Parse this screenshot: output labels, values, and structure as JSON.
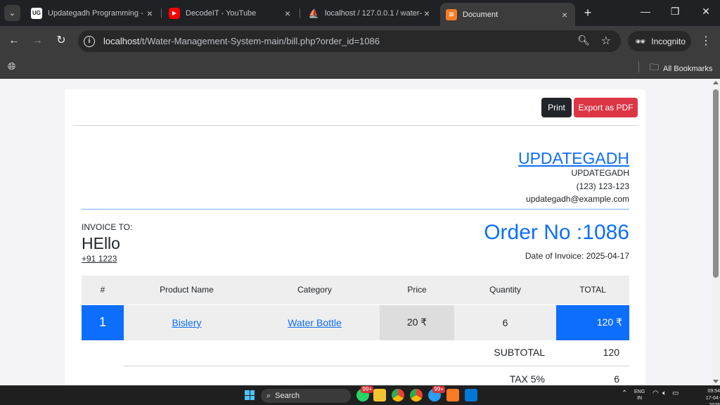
{
  "browser": {
    "tabs": [
      {
        "title": "Updategadh Programming -",
        "favicon": "ug-logo-icon",
        "active": false
      },
      {
        "title": "DecodeIT - YouTube",
        "favicon": "youtube-icon",
        "active": false
      },
      {
        "title": "localhost / 127.0.0.1 / water-",
        "favicon": "phpmyadmin-icon",
        "active": false
      },
      {
        "title": "Document",
        "favicon": "xampp-icon",
        "active": true
      }
    ],
    "url_host": "localhost",
    "url_path": "/t/Water-Management-System-main/bill.php?order_id=1086",
    "incognito_label": "Incognito",
    "bookmarks_label": "All Bookmarks"
  },
  "actions": {
    "print_label": "Print",
    "export_label": "Export as PDF"
  },
  "company": {
    "name": "UPDATEGADH",
    "subname": "UPDATEGADH",
    "phone": "(123) 123-123",
    "email": "updategadh@example.com"
  },
  "invoice": {
    "to_label": "INVOICE TO:",
    "customer_name": "HEllo",
    "customer_phone": "+91 1223",
    "order_title": "Order No :1086",
    "date_text": "Date of Invoice: 2025-04-17"
  },
  "table": {
    "headers": [
      "#",
      "Product Name",
      "Category",
      "Price",
      "Quantity",
      "TOTAL"
    ],
    "rows": [
      {
        "index": "1",
        "product": "Bislery",
        "category": "Water Bottle",
        "price": "20 ₹",
        "quantity": "6",
        "total": "120 ₹"
      }
    ]
  },
  "summary": {
    "subtotal_label": "SUBTOTAL",
    "subtotal_value": "120",
    "tax_label": "TAX 5%",
    "tax_value": "6"
  },
  "taskbar": {
    "search_label": "Search",
    "badge": "99+",
    "lang_line1": "ENG",
    "lang_line2": "IN",
    "time": "09:54",
    "date": "17-04-2025"
  },
  "colors": {
    "primary": "#0d6efd",
    "danger": "#dc3545",
    "dark": "#212529"
  }
}
